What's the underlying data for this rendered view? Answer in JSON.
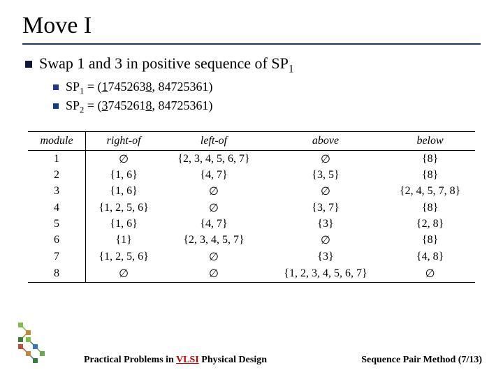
{
  "title": "Move I",
  "main_bullet": "Swap 1 and 3 in positive sequence of SP",
  "main_bullet_sub": "1",
  "sub_bullets": [
    {
      "label": "SP",
      "sub": "1",
      "eq": " = (",
      "u1": "1",
      "mid": "745263",
      "u2": "8",
      "rest": ", 84725361)"
    },
    {
      "label": "SP",
      "sub": "2",
      "eq": " = (",
      "u1": "3",
      "mid": "745261",
      "u2": "8",
      "rest": ", 84725361)"
    }
  ],
  "table": {
    "headers": [
      "module",
      "right-of",
      "left-of",
      "above",
      "below"
    ],
    "rows": [
      {
        "m": "1",
        "r": "∅",
        "l": "{2, 3, 4, 5, 6, 7}",
        "a": "∅",
        "b": "{8}"
      },
      {
        "m": "2",
        "r": "{1, 6}",
        "l": "{4, 7}",
        "a": "{3, 5}",
        "b": "{8}"
      },
      {
        "m": "3",
        "r": "{1, 6}",
        "l": "∅",
        "a": "∅",
        "b": "{2, 4, 5, 7, 8}"
      },
      {
        "m": "4",
        "r": "{1, 2, 5, 6}",
        "l": "∅",
        "a": "{3, 7}",
        "b": "{8}"
      },
      {
        "m": "5",
        "r": "{1, 6}",
        "l": "{4, 7}",
        "a": "{3}",
        "b": "{2, 8}"
      },
      {
        "m": "6",
        "r": "{1}",
        "l": "{2, 3, 4, 5, 7}",
        "a": "∅",
        "b": "{8}"
      },
      {
        "m": "7",
        "r": "{1, 2, 5, 6}",
        "l": "∅",
        "a": "{3}",
        "b": "{4, 8}"
      },
      {
        "m": "8",
        "r": "∅",
        "l": "∅",
        "a": "{1, 2, 3, 4, 5, 6, 7}",
        "b": "∅"
      }
    ]
  },
  "footer_left_pre": "Practical Problems in ",
  "footer_left_vlsi": "VLSI",
  "footer_left_post": " Physical Design",
  "footer_right": "Sequence Pair Method (7/13)"
}
